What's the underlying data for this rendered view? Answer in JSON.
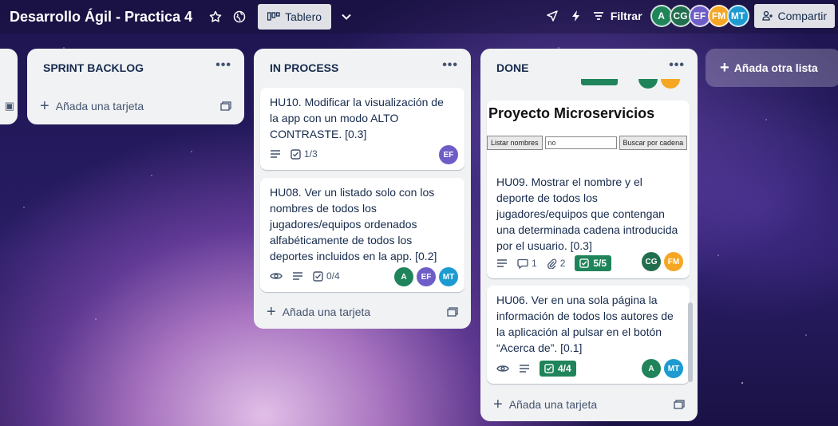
{
  "header": {
    "board_title": "Desarrollo Ágil - Practica 4",
    "view_label": "Tablero",
    "filter_label": "Filtrar",
    "share_label": "Compartir",
    "members": [
      "A",
      "CG",
      "EF",
      "FM",
      "MT"
    ]
  },
  "lists": [
    {
      "title": "SPRINT BACKLOG",
      "add_card": "Añada una tarjeta"
    },
    {
      "title": "IN PROCESS",
      "add_card": "Añada una tarjeta",
      "cards": [
        {
          "text": "HU10. Modificar la visualización de la app con un modo ALTO CONTRASTE. [0.3]",
          "checklist": "1/3",
          "members": [
            "EF"
          ]
        },
        {
          "text": "HU08. Ver un listado solo con los nombres de todos los jugadores/equipos ordenados alfabéticamente de todos los deportes incluidos en la app. [0.2]",
          "checklist": "0/4",
          "members": [
            "A",
            "EF",
            "MT"
          ]
        }
      ]
    },
    {
      "title": "DONE",
      "add_card": "Añada una tarjeta",
      "cards": [
        {
          "cover": {
            "title": "Proyecto Microservicios",
            "btn1": "Listar nombres",
            "input": "no",
            "btn2": "Buscar por cadena"
          },
          "text": "HU09. Mostrar el nombre y el deporte de todos los jugadores/equipos que contengan una determinada cadena introducida por el usuario. [0.3]",
          "comments": "1",
          "attachments": "2",
          "checklist": "5/5",
          "members": [
            "CG",
            "FM"
          ]
        },
        {
          "text": "HU06. Ver en una sola página la información de todos los autores de la aplicación al pulsar en el botón “Acerca de”. [0.1]",
          "checklist": "4/4",
          "members": [
            "A",
            "MT"
          ]
        }
      ]
    }
  ],
  "add_list_label": "Añada otra lista",
  "colors": {
    "A": "#1f845a",
    "CG": "#216e4e",
    "EF": "#6e5dc6",
    "FM": "#f5a623",
    "MT": "#1d9bd1",
    "check_done": "#1f845a"
  }
}
